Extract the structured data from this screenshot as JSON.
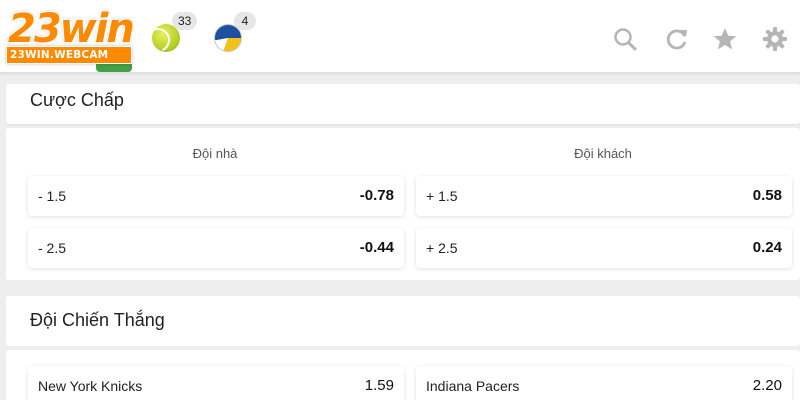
{
  "logo": {
    "main": "23win",
    "sub": "23WIN.WEBCAM"
  },
  "sports": [
    {
      "name": "tennis-ball",
      "count": "33"
    },
    {
      "name": "volleyball",
      "count": "4"
    }
  ],
  "toolbar_icons": [
    "search-icon",
    "refresh-icon",
    "star-icon",
    "gear-icon"
  ],
  "handicap": {
    "title": "Cược Chấp",
    "home_header": "Đội nhà",
    "away_header": "Đội khách",
    "rows": [
      {
        "home_line": "- 1.5",
        "home_odds": "-0.78",
        "away_line": "+ 1.5",
        "away_odds": "0.58"
      },
      {
        "home_line": "- 2.5",
        "home_odds": "-0.44",
        "away_line": "+ 2.5",
        "away_odds": "0.24"
      }
    ]
  },
  "winner": {
    "title": "Đội Chiến Thắng",
    "home_team": "New York Knicks",
    "home_odds": "1.59",
    "away_team": "Indiana Pacers",
    "away_odds": "2.20"
  },
  "colors": {
    "brand_orange": "#ff8a00",
    "accent_green": "#43a047",
    "icon_grey": "#b5b5b5"
  }
}
